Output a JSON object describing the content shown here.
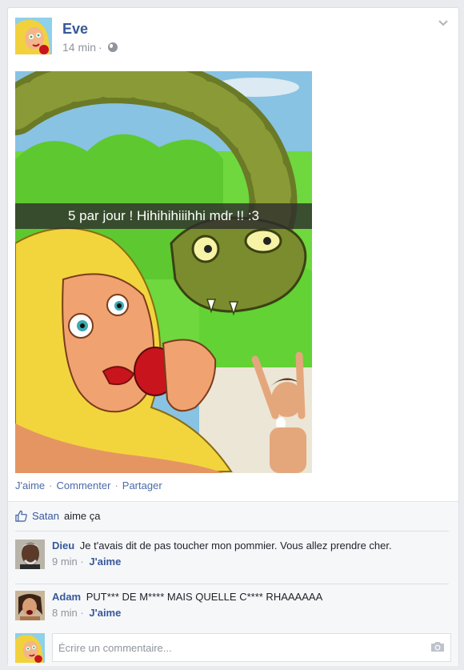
{
  "post": {
    "author": "Eve",
    "time": "14 min",
    "time_sep": "·",
    "privacy_icon": "globe-icon",
    "menu_icon": "chevron-down-icon",
    "photo_caption": "5 par jour ! Hihihihiiihhi mdr !! :3",
    "photo_description": "cartoon of Eve biting an apple, a large snake and Adam screaming"
  },
  "actions": {
    "like": "J'aime",
    "sep1": "·",
    "comment": "Commenter",
    "sep2": "·",
    "share": "Partager"
  },
  "likes": {
    "icon": "thumbs-up-icon",
    "liker": "Satan",
    "suffix": "aime ça"
  },
  "comments": [
    {
      "author": "Dieu",
      "text": "Je t'avais dit de pas toucher mon pommier. Vous allez prendre cher.",
      "time": "9 min",
      "sep": "·",
      "like": "J'aime"
    },
    {
      "author": "Adam",
      "text": "PUT*** DE M**** MAIS QUELLE C**** RHAAAAAA",
      "time": "8 min",
      "sep": "·",
      "like": "J'aime"
    }
  ],
  "composer": {
    "placeholder": "Écrire un commentaire...",
    "camera_icon": "camera-icon"
  },
  "colors": {
    "link": "#365899",
    "meta": "#90949c",
    "text": "#1d2129",
    "background": "#e9ebee"
  }
}
